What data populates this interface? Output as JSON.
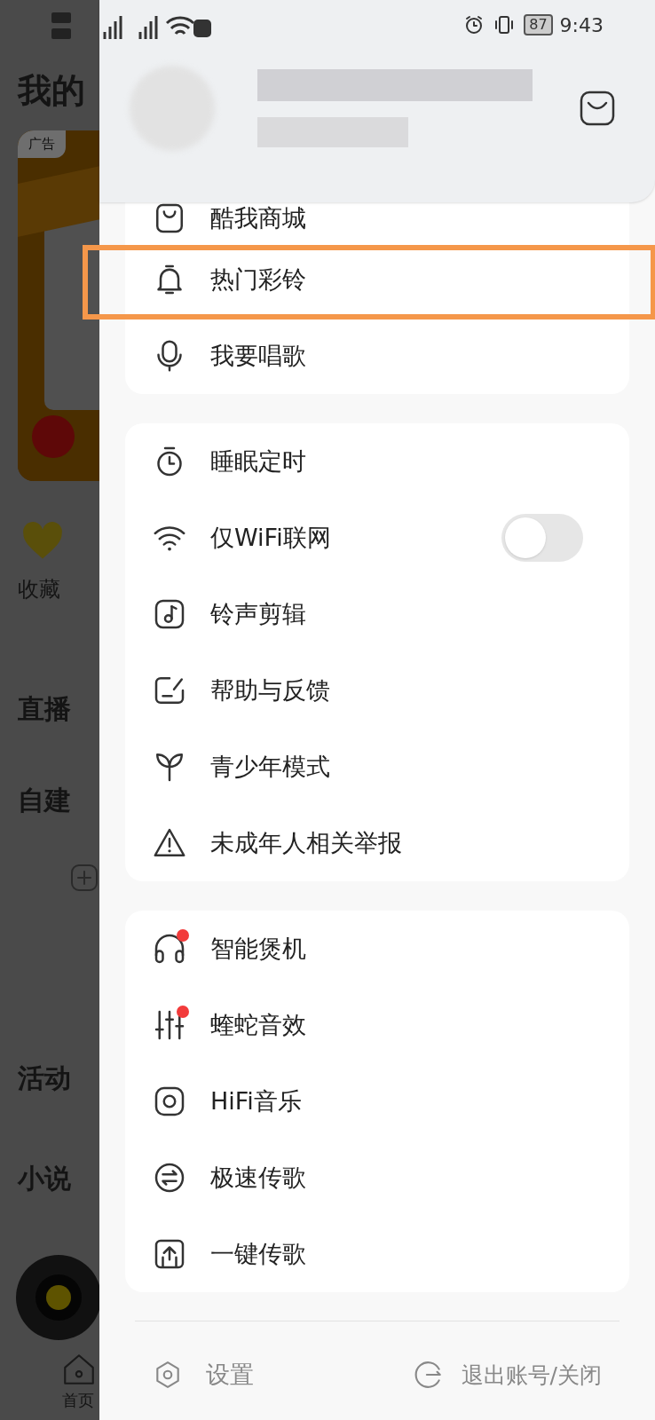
{
  "status_bar": {
    "battery": "87",
    "time": "9:43"
  },
  "background": {
    "title": "我的",
    "ad_tag": "广告",
    "favorites": "收藏",
    "sections": [
      "直播",
      "自建",
      "活动",
      "小说"
    ],
    "nav": "首页"
  },
  "drawer": {
    "groups": [
      {
        "items": [
          {
            "label": "酷我商城",
            "kind": "link",
            "badge": false,
            "highlighted": false
          },
          {
            "label": "热门彩铃",
            "kind": "link",
            "badge": false,
            "highlighted": true
          },
          {
            "label": "我要唱歌",
            "kind": "link",
            "badge": false,
            "highlighted": false
          }
        ]
      },
      {
        "items": [
          {
            "label": "睡眠定时",
            "kind": "link",
            "badge": false,
            "highlighted": false
          },
          {
            "label": "仅WiFi联网",
            "kind": "toggle",
            "on": false,
            "badge": false,
            "highlighted": false
          },
          {
            "label": "铃声剪辑",
            "kind": "link",
            "badge": false,
            "highlighted": false
          },
          {
            "label": "帮助与反馈",
            "kind": "link",
            "badge": false,
            "highlighted": false
          },
          {
            "label": "青少年模式",
            "kind": "link",
            "badge": false,
            "highlighted": false
          },
          {
            "label": "未成年人相关举报",
            "kind": "link",
            "badge": false,
            "highlighted": false
          }
        ]
      },
      {
        "items": [
          {
            "label": "智能煲机",
            "kind": "link",
            "badge": true,
            "highlighted": false
          },
          {
            "label": "蝰蛇音效",
            "kind": "link",
            "badge": true,
            "highlighted": false
          },
          {
            "label": "HiFi音乐",
            "kind": "link",
            "badge": false,
            "highlighted": false
          },
          {
            "label": "极速传歌",
            "kind": "link",
            "badge": false,
            "highlighted": false
          },
          {
            "label": "一键传歌",
            "kind": "link",
            "badge": false,
            "highlighted": false
          }
        ]
      }
    ],
    "footer": [
      {
        "label": "设置"
      },
      {
        "label": "退出账号/关闭"
      }
    ]
  }
}
